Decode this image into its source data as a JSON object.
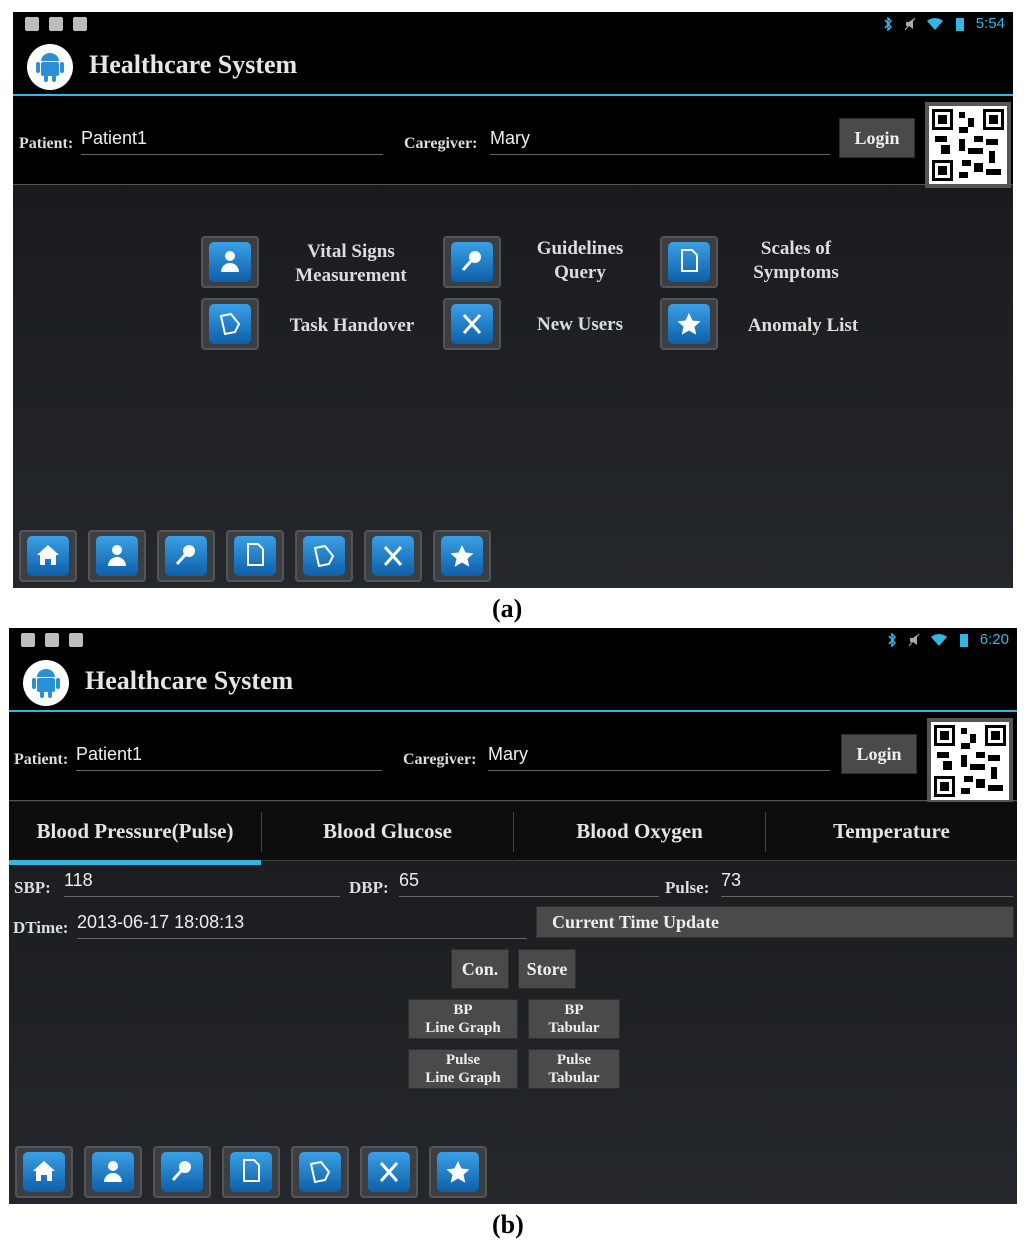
{
  "screen_a": {
    "status": {
      "time": "5:54"
    },
    "app_title": "Healthcare System",
    "patient": {
      "label": "Patient:",
      "value": "Patient1"
    },
    "caregiver": {
      "label": "Caregiver:",
      "value": "Mary"
    },
    "login_label": "Login",
    "menu": [
      {
        "icon": "person-icon",
        "label_line1": "Vital Signs",
        "label_line2": "Measurement"
      },
      {
        "icon": "magnifier-icon",
        "label_line1": "Guidelines",
        "label_line2": "Query"
      },
      {
        "icon": "document-icon",
        "label_line1": "Scales of",
        "label_line2": "Symptoms"
      },
      {
        "icon": "folder-icon",
        "label_line1": "Task Handover",
        "label_line2": ""
      },
      {
        "icon": "tools-icon",
        "label_line1": "New Users",
        "label_line2": ""
      },
      {
        "icon": "star-icon",
        "label_line1": "Anomaly List",
        "label_line2": ""
      }
    ],
    "bottom_nav": [
      "home-icon",
      "person-icon",
      "magnifier-icon",
      "document-icon",
      "folder-icon",
      "tools-icon",
      "star-icon"
    ]
  },
  "caption_a": "(a)",
  "screen_b": {
    "status": {
      "time": "6:20"
    },
    "app_title": "Healthcare System",
    "patient": {
      "label": "Patient:",
      "value": "Patient1"
    },
    "caregiver": {
      "label": "Caregiver:",
      "value": "Mary"
    },
    "login_label": "Login",
    "tabs": [
      "Blood Pressure(Pulse)",
      "Blood Glucose",
      "Blood Oxygen",
      "Temperature"
    ],
    "active_tab": "Blood Pressure(Pulse)",
    "sbp": {
      "label": "SBP:",
      "value": "118"
    },
    "dbp": {
      "label": "DBP:",
      "value": "65"
    },
    "pulse": {
      "label": "Pulse:",
      "value": "73"
    },
    "dtime": {
      "label": "DTime:",
      "value": "2013-06-17 18:08:13"
    },
    "current_time_update": "Current Time Update",
    "con_label": "Con.",
    "store_label": "Store",
    "bp_line_graph": {
      "line1": "BP",
      "line2": "Line Graph"
    },
    "bp_tabular": {
      "line1": "BP",
      "line2": "Tabular"
    },
    "pulse_line_graph": {
      "line1": "Pulse",
      "line2": "Line Graph"
    },
    "pulse_tabular": {
      "line1": "Pulse",
      "line2": "Tabular"
    },
    "bottom_nav": [
      "home-icon",
      "person-icon",
      "magnifier-icon",
      "document-icon",
      "folder-icon",
      "tools-icon",
      "star-icon"
    ]
  },
  "caption_b": "(b)",
  "colors": {
    "accent": "#33b5e5",
    "background": "#1b1d20",
    "button": "#4a4a4a"
  }
}
